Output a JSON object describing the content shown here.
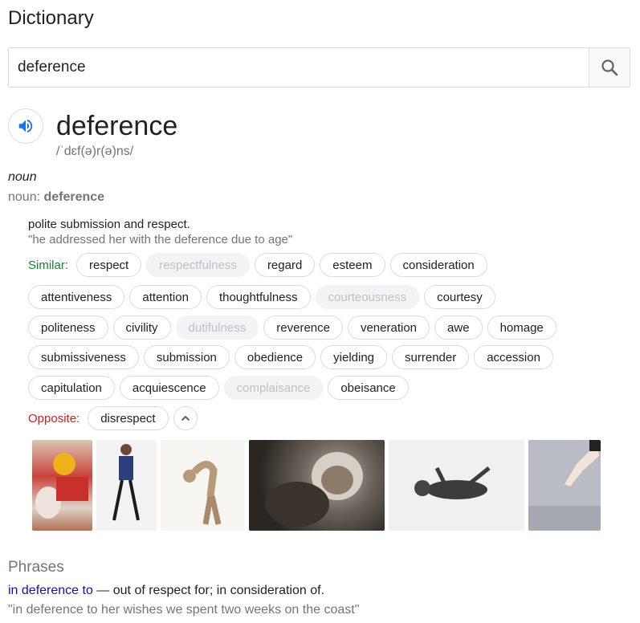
{
  "app": {
    "title": "Dictionary"
  },
  "search": {
    "value": "deference"
  },
  "entry": {
    "word": "deference",
    "phonetic": "/ˈdɛf(ə)r(ə)ns/",
    "part_of_speech": "noun",
    "noun_prefix": "noun: ",
    "noun_word": "deference",
    "definition": "polite submission and respect.",
    "example": "\"he addressed her with the deference due to age\""
  },
  "similar": {
    "label": "Similar:",
    "rows": [
      [
        {
          "text": "respect",
          "dim": false
        },
        {
          "text": "respectfulness",
          "dim": true
        },
        {
          "text": "regard",
          "dim": false
        },
        {
          "text": "esteem",
          "dim": false
        },
        {
          "text": "consideration",
          "dim": false
        }
      ],
      [
        {
          "text": "attentiveness",
          "dim": false
        },
        {
          "text": "attention",
          "dim": false
        },
        {
          "text": "thoughtfulness",
          "dim": false
        },
        {
          "text": "courteousness",
          "dim": true
        },
        {
          "text": "courtesy",
          "dim": false
        }
      ],
      [
        {
          "text": "politeness",
          "dim": false
        },
        {
          "text": "civility",
          "dim": false
        },
        {
          "text": "dutifulness",
          "dim": true
        },
        {
          "text": "reverence",
          "dim": false
        },
        {
          "text": "veneration",
          "dim": false
        },
        {
          "text": "awe",
          "dim": false
        },
        {
          "text": "homage",
          "dim": false
        }
      ],
      [
        {
          "text": "submissiveness",
          "dim": false
        },
        {
          "text": "submission",
          "dim": false
        },
        {
          "text": "obedience",
          "dim": false
        },
        {
          "text": "yielding",
          "dim": false
        },
        {
          "text": "surrender",
          "dim": false
        },
        {
          "text": "accession",
          "dim": false
        }
      ],
      [
        {
          "text": "capitulation",
          "dim": false
        },
        {
          "text": "acquiescence",
          "dim": false
        },
        {
          "text": "complaisance",
          "dim": true
        },
        {
          "text": "obeisance",
          "dim": false
        }
      ]
    ]
  },
  "opposite": {
    "label": "Opposite:",
    "words": [
      "disrespect"
    ]
  },
  "images": [
    {
      "name": "image-bear-mask-photo"
    },
    {
      "name": "image-woman-curtsy-photo"
    },
    {
      "name": "image-bowing-figure-photo"
    },
    {
      "name": "image-monkey-photo"
    },
    {
      "name": "image-dog-lying-photo"
    },
    {
      "name": "image-pointing-hand-photo"
    }
  ],
  "phrases": {
    "title": "Phrases",
    "items": [
      {
        "phrase": "in deference to",
        "meaning": " — out of respect for; in consideration of.",
        "example": "\"in deference to her wishes we spent two weeks on the coast\""
      }
    ]
  },
  "colors": {
    "similar_label": "#188038",
    "opposite_label": "#c5221f",
    "link": "#1a0dab",
    "accent": "#1a73e8"
  }
}
